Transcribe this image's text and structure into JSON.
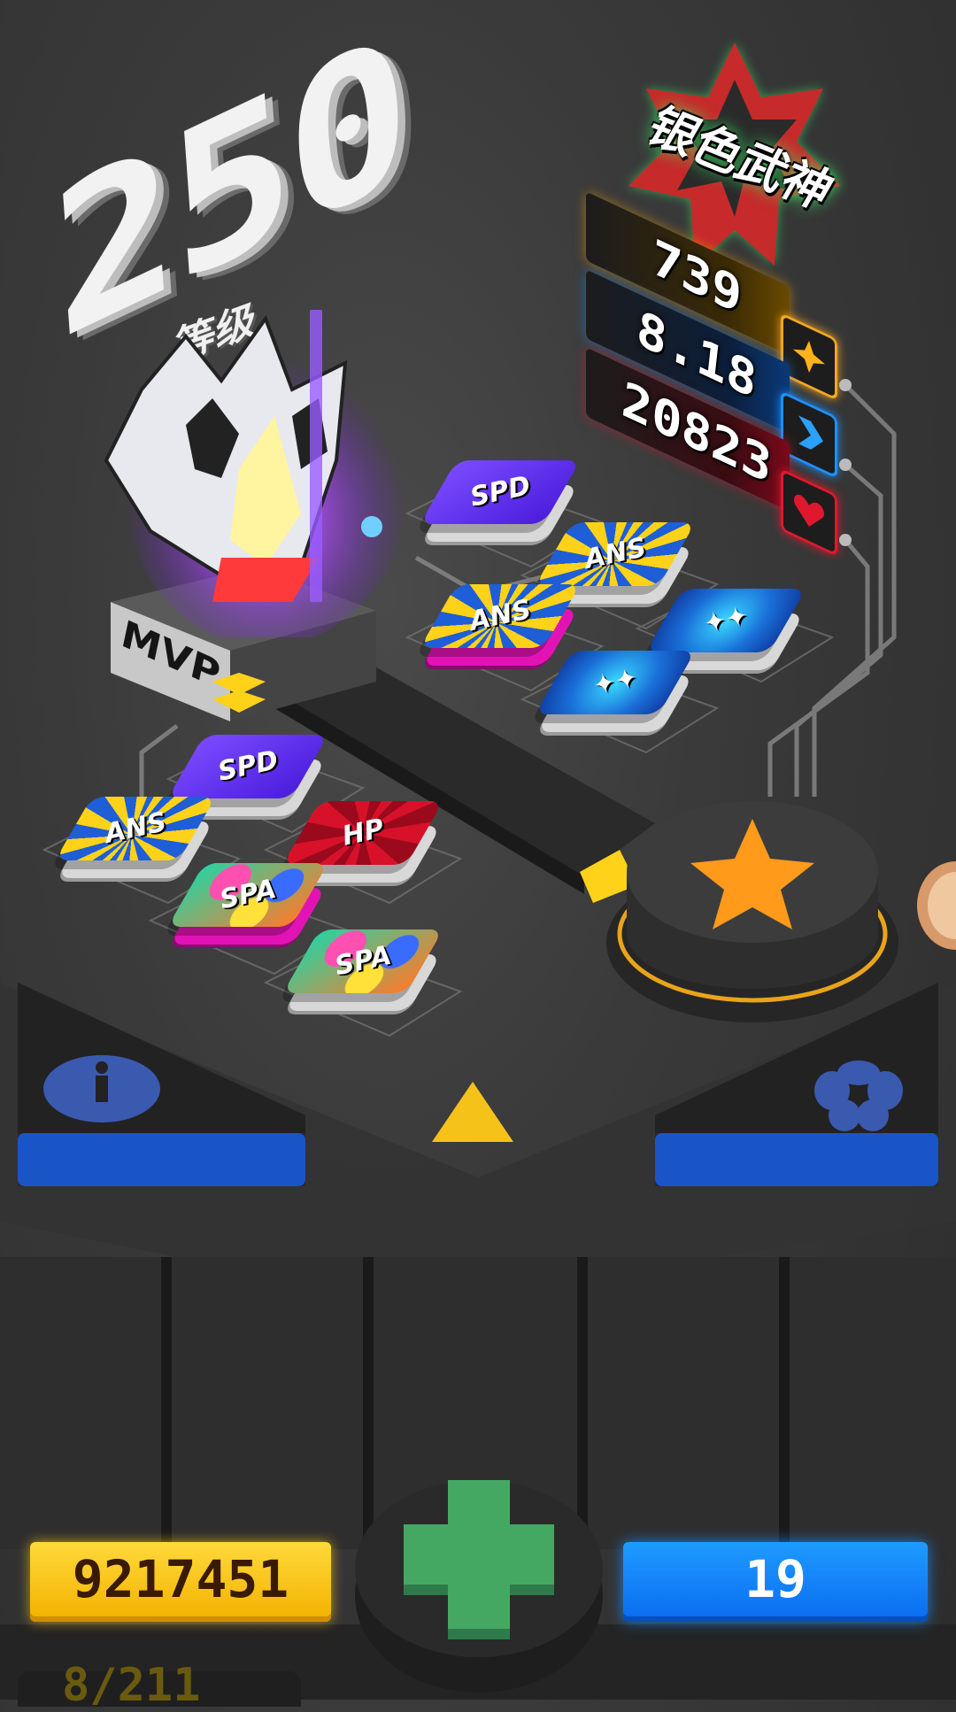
{
  "level": {
    "value": "250",
    "label": "等级"
  },
  "rank": {
    "title": "银色武神"
  },
  "stats": [
    {
      "name": "attack",
      "value": "739",
      "icon": "star-icon",
      "color": "#f5a623"
    },
    {
      "name": "speed",
      "value": "8.18",
      "icon": "arrow-right-icon",
      "color": "#1e90ff"
    },
    {
      "name": "hp",
      "value": "20823",
      "icon": "heart-icon",
      "color": "#e0182d"
    }
  ],
  "pedestal": {
    "label": "MVP"
  },
  "tiles": {
    "upper": [
      {
        "label": "SPD",
        "style": "spd"
      },
      {
        "label": "ANS",
        "style": "ans"
      },
      {
        "label": "ANS",
        "style": "ans"
      },
      {
        "label": "✦✦",
        "style": "gem"
      },
      {
        "label": "✦✦",
        "style": "gem"
      }
    ],
    "lower": [
      {
        "label": "SPD",
        "style": "spd"
      },
      {
        "label": "ANS",
        "style": "ans"
      },
      {
        "label": "HP",
        "style": "hp"
      },
      {
        "label": "SPA",
        "style": "spa"
      },
      {
        "label": "SPA",
        "style": "spa"
      }
    ]
  },
  "buttons": {
    "info": "info-icon",
    "team": "team-icon",
    "star": "star-icon",
    "add": "plus-icon"
  },
  "currency": {
    "gold": "9217451",
    "gems": "19"
  },
  "colors": {
    "gold": "#ffd21a",
    "blue": "#0a6bf0",
    "green": "#3fa863",
    "orange": "#ff9a1a"
  },
  "bottom_counter": "8/211"
}
